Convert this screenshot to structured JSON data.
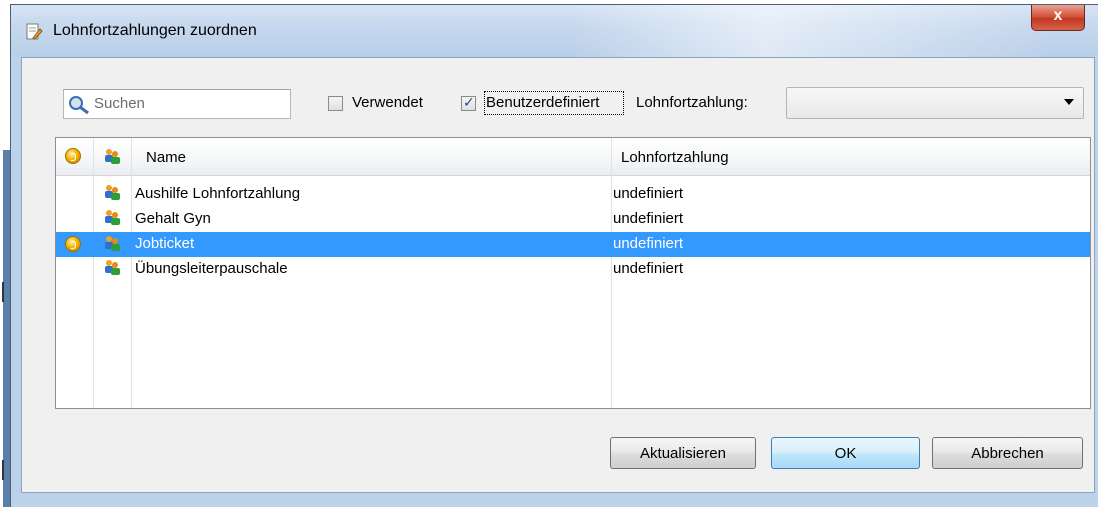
{
  "window": {
    "title": "Lohnfortzahlungen zuordnen",
    "close_label": "x"
  },
  "filters": {
    "search_placeholder": "Suchen",
    "search_value": "",
    "used_label": "Verwendet",
    "used_checked": false,
    "custom_label": "Benutzerdefiniert",
    "custom_checked": true,
    "payment_label": "Lohnfortzahlung:",
    "payment_value": ""
  },
  "grid": {
    "columns": [
      "Name",
      "Lohnfortzahlung"
    ],
    "rows": [
      {
        "name": "Aushilfe Lohnfortzahlung",
        "payment": "undefiniert",
        "coin": false,
        "selected": false
      },
      {
        "name": "Gehalt Gyn",
        "payment": "undefiniert",
        "coin": false,
        "selected": false
      },
      {
        "name": "Jobticket",
        "payment": "undefiniert",
        "coin": true,
        "selected": true
      },
      {
        "name": "Übungsleiterpauschale",
        "payment": "undefiniert",
        "coin": false,
        "selected": false
      }
    ]
  },
  "buttons": {
    "refresh": "Aktualisieren",
    "ok": "OK",
    "cancel": "Abbrechen"
  },
  "colors": {
    "selection": "#3399ff",
    "close_button": "#c9442c",
    "titlebar": "#c6d8ee"
  },
  "icons": {
    "coin": "coin-icon",
    "users": "users-icon",
    "search": "search-icon"
  }
}
